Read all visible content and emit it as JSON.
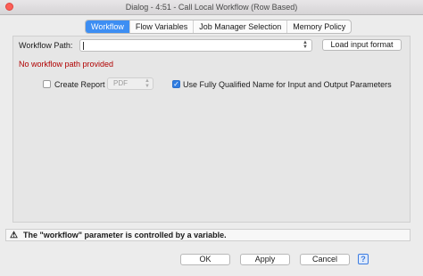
{
  "window": {
    "title": "Dialog - 4:51 - Call Local Workflow (Row Based)"
  },
  "tabs": [
    {
      "label": "Workflow",
      "active": true
    },
    {
      "label": "Flow Variables",
      "active": false
    },
    {
      "label": "Job Manager Selection",
      "active": false
    },
    {
      "label": "Memory Policy",
      "active": false
    }
  ],
  "workflow": {
    "path_label": "Workflow Path:",
    "path_value": "",
    "load_button": "Load input format",
    "error": "No workflow path provided"
  },
  "options": {
    "create_report_label": "Create Report",
    "create_report_checked": false,
    "report_format": "PDF",
    "fqn_label": "Use Fully Qualified Name for Input and Output Parameters",
    "fqn_checked": true
  },
  "status": {
    "message": "The \"workflow\" parameter is controlled by a variable.",
    "icon": "warning-icon"
  },
  "footer": {
    "ok": "OK",
    "apply": "Apply",
    "cancel": "Cancel",
    "help": "?"
  },
  "colors": {
    "accent": "#3d8ef3",
    "error": "#b00000",
    "close": "#fc5f57"
  }
}
